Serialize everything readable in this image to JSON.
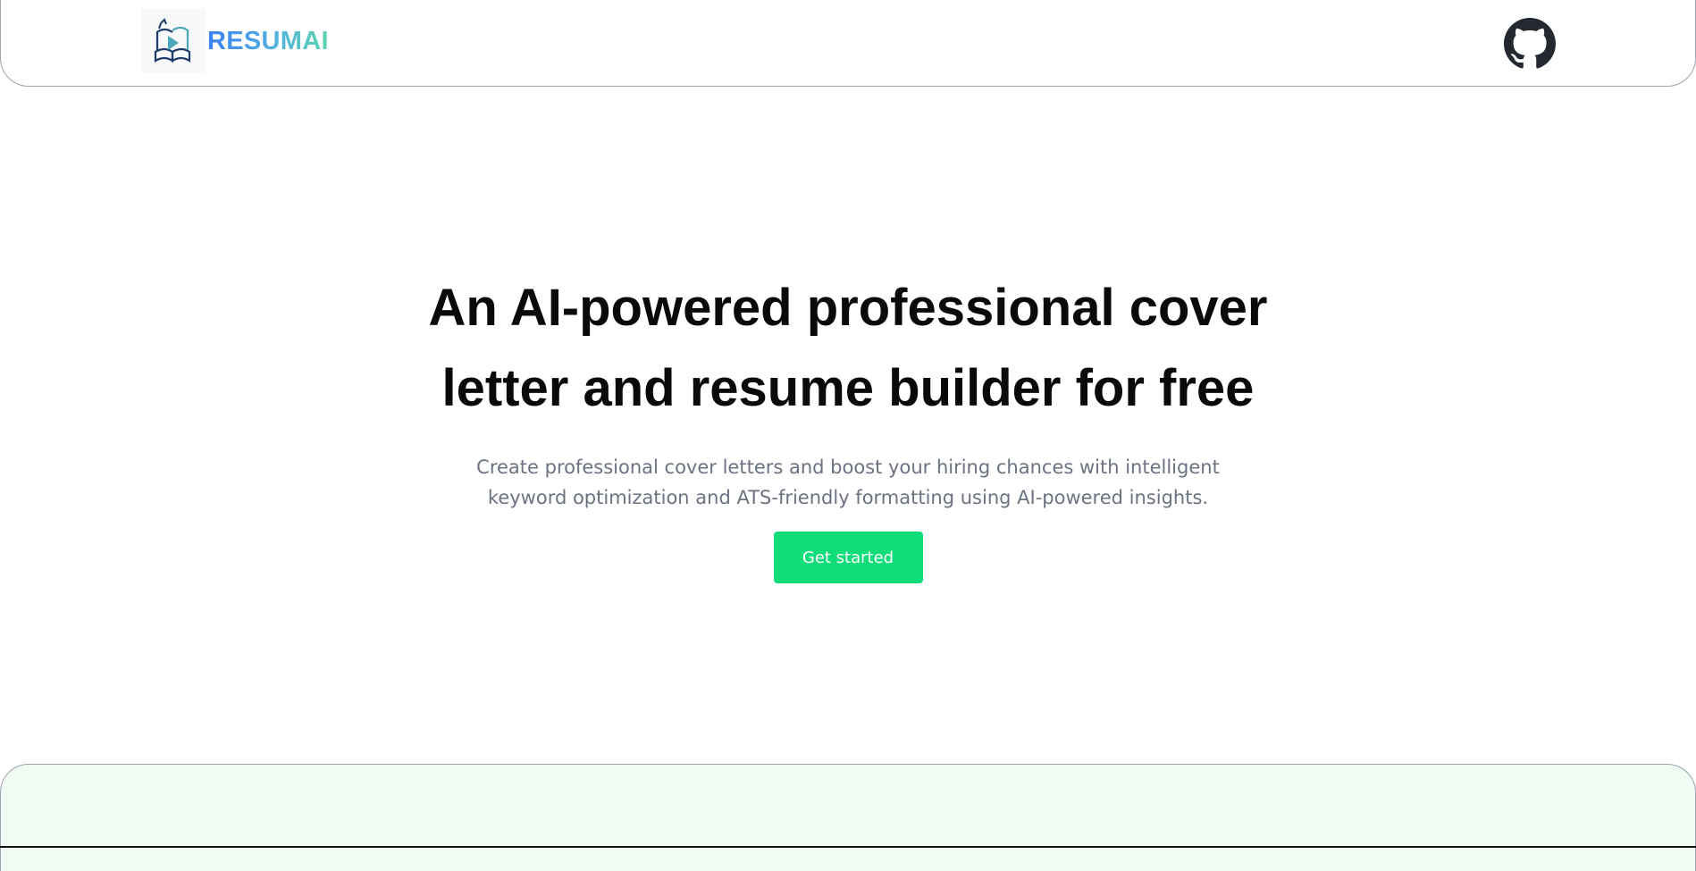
{
  "header": {
    "brand_name": "RESUMAI",
    "logo_icon": "book-play-logo-icon",
    "github_icon": "github-icon"
  },
  "hero": {
    "title": "An AI-powered professional cover letter and resume builder for free",
    "subtitle": "Create professional cover letters and boost your hiring chances with intelligent keyword optimization and ATS-friendly formatting using AI-powered insights.",
    "cta_label": "Get started"
  },
  "colors": {
    "accent": "#10dc7a",
    "brand_gradient_start": "#3b82f6",
    "brand_gradient_end": "#5cd6b0",
    "bottom_section_bg": "#effbf3",
    "title_text": "#0a0a0a",
    "subtitle_text": "#6b7280"
  }
}
